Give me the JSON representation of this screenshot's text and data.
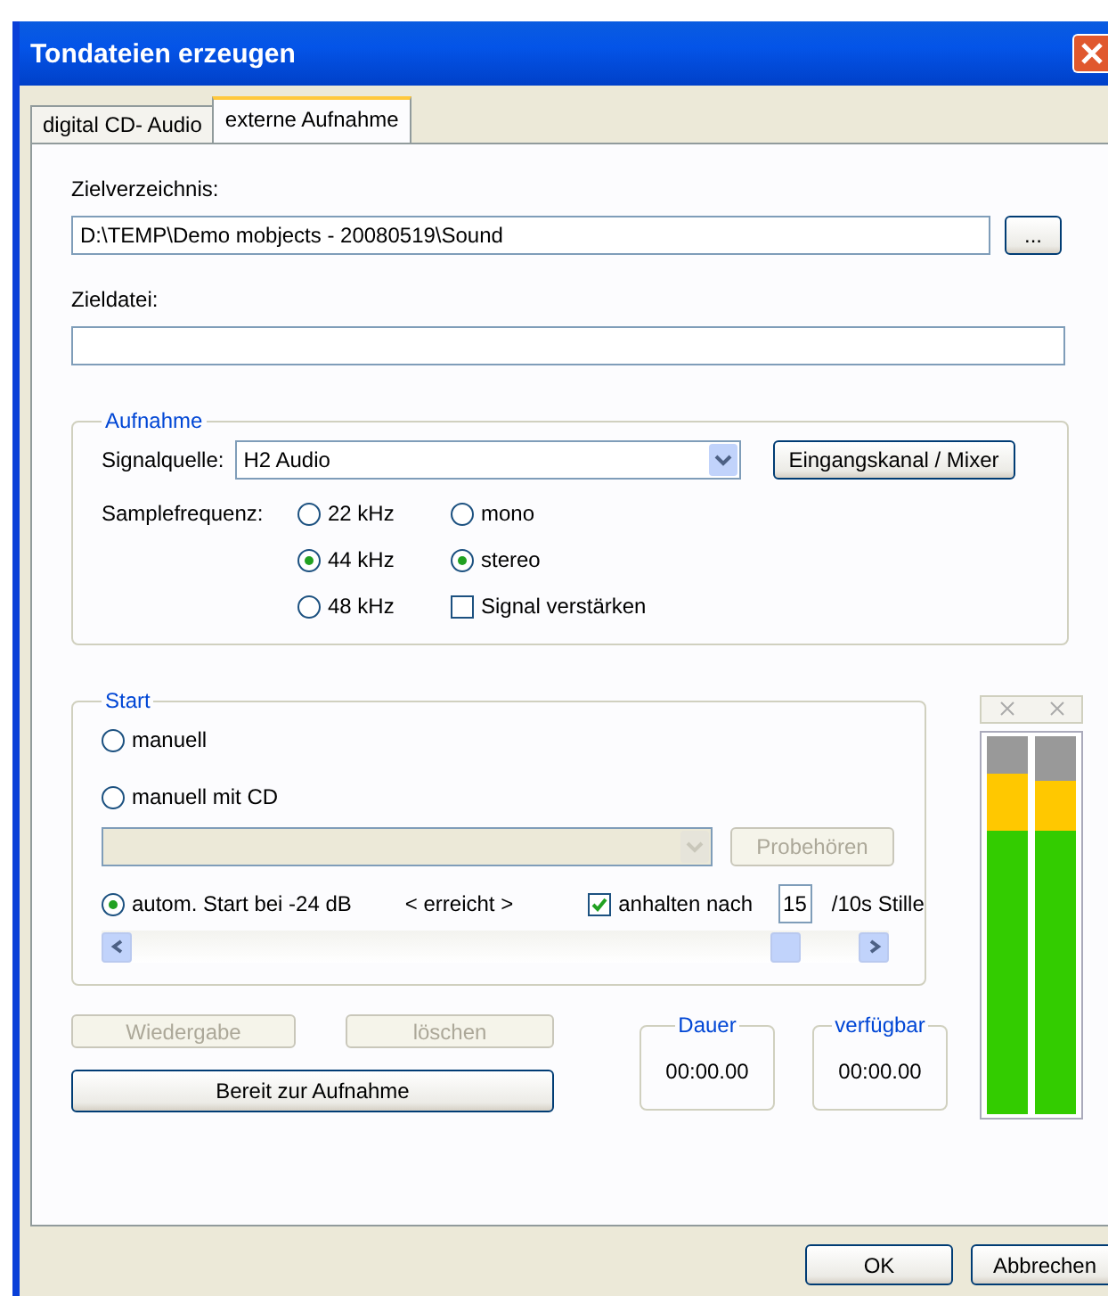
{
  "window": {
    "title": "Tondateien erzeugen"
  },
  "tabs": [
    {
      "label": "digital CD- Audio",
      "selected": false
    },
    {
      "label": "externe Aufnahme",
      "selected": true
    }
  ],
  "target_dir": {
    "label": "Zielverzeichnis:",
    "value": "D:\\TEMP\\Demo mobjects - 20080519\\Sound",
    "browse": "..."
  },
  "target_file": {
    "label": "Zieldatei:"
  },
  "recording": {
    "title": "Aufnahme",
    "source_label": "Signalquelle:",
    "source": "H2 Audio",
    "mixer_button": "Eingangskanal / Mixer",
    "rate_label": "Samplefrequenz:",
    "rates": [
      {
        "label": "22 kHz",
        "selected": false
      },
      {
        "label": "44 kHz",
        "selected": true
      },
      {
        "label": "48 kHz",
        "selected": false
      }
    ],
    "modes": [
      {
        "label": "mono",
        "selected": false
      },
      {
        "label": "stereo",
        "selected": true
      }
    ],
    "amplify": {
      "label": "Signal verstärken",
      "checked": false
    }
  },
  "start": {
    "title": "Start",
    "options": [
      {
        "label": "manuell",
        "selected": false
      },
      {
        "label": "manuell mit CD",
        "selected": false
      },
      {
        "label": "autom. Start bei -24 dB",
        "selected": true
      }
    ],
    "cd_select": {
      "disabled": true
    },
    "preview_button": {
      "label": "Probehören",
      "disabled": true
    },
    "reached": "< erreicht >",
    "stop_after": {
      "label": "anhalten nach",
      "checked": true,
      "value": "15",
      "unit": "/10s Stille"
    },
    "threshold": {
      "level": 0.9
    }
  },
  "playback_button": {
    "label": "Wiedergabe",
    "disabled": true
  },
  "delete_button": {
    "label": "löschen",
    "disabled": true
  },
  "ready_button": {
    "label": "Bereit zur Aufnahme",
    "disabled": false
  },
  "duration": {
    "title": "Dauer",
    "value": "00:00.00"
  },
  "available": {
    "title": "verfügbar",
    "value": "00:00.00"
  },
  "meter": {
    "channels": [
      {
        "level": 0.9
      },
      {
        "level": 0.88
      }
    ]
  },
  "buttons": [
    {
      "label": "OK"
    },
    {
      "label": "Abbrechen"
    }
  ]
}
